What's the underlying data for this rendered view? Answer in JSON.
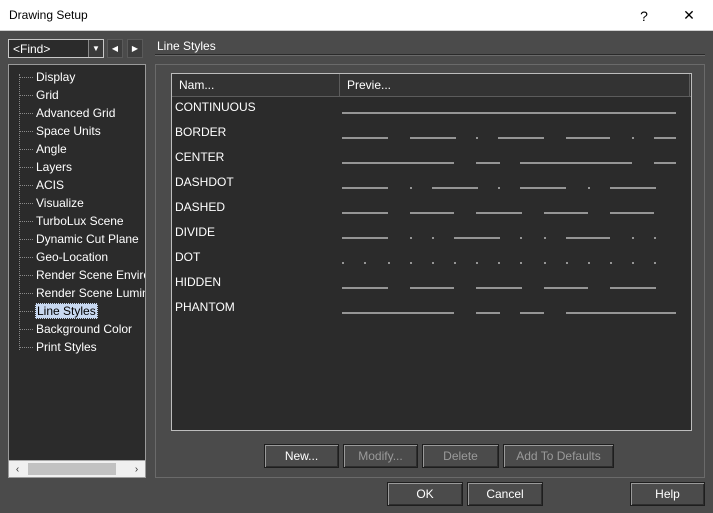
{
  "window": {
    "title": "Drawing Setup",
    "help_glyph": "?",
    "close_glyph": "✕"
  },
  "find": {
    "value": "<Find>"
  },
  "tree": {
    "items": [
      {
        "label": "Display"
      },
      {
        "label": "Grid"
      },
      {
        "label": "Advanced Grid"
      },
      {
        "label": "Space Units"
      },
      {
        "label": "Angle"
      },
      {
        "label": "Layers"
      },
      {
        "label": "ACIS"
      },
      {
        "label": "Visualize"
      },
      {
        "label": "TurboLux Scene"
      },
      {
        "label": "Dynamic Cut Plane"
      },
      {
        "label": "Geo-Location"
      },
      {
        "label": "Render Scene Environment"
      },
      {
        "label": "Render Scene Luminance"
      },
      {
        "label": "Line Styles",
        "selected": true
      },
      {
        "label": "Background Color"
      },
      {
        "label": "Print Styles"
      }
    ]
  },
  "section": {
    "title": "Line Styles"
  },
  "list": {
    "columns": [
      "Nam...",
      "Previe..."
    ],
    "rows": [
      {
        "name": "CONTINUOUS",
        "pattern": "continuous"
      },
      {
        "name": "BORDER",
        "pattern": "border"
      },
      {
        "name": "CENTER",
        "pattern": "center"
      },
      {
        "name": "DASHDOT",
        "pattern": "dashdot"
      },
      {
        "name": "DASHED",
        "pattern": "dashed"
      },
      {
        "name": "DIVIDE",
        "pattern": "divide"
      },
      {
        "name": "DOT",
        "pattern": "dot"
      },
      {
        "name": "HIDDEN",
        "pattern": "hidden"
      },
      {
        "name": "PHANTOM",
        "pattern": "phantom"
      }
    ]
  },
  "buttons": {
    "new": "New...",
    "modify": "Modify...",
    "delete": "Delete",
    "add_defaults": "Add To Defaults",
    "ok": "OK",
    "cancel": "Cancel",
    "help": "Help"
  },
  "colors": {
    "background": "#4b4b4b",
    "panel": "#2b2b2b",
    "selection": "#c8d8f0",
    "text": "#ffffff",
    "disabled_text": "#9a9a9a"
  }
}
